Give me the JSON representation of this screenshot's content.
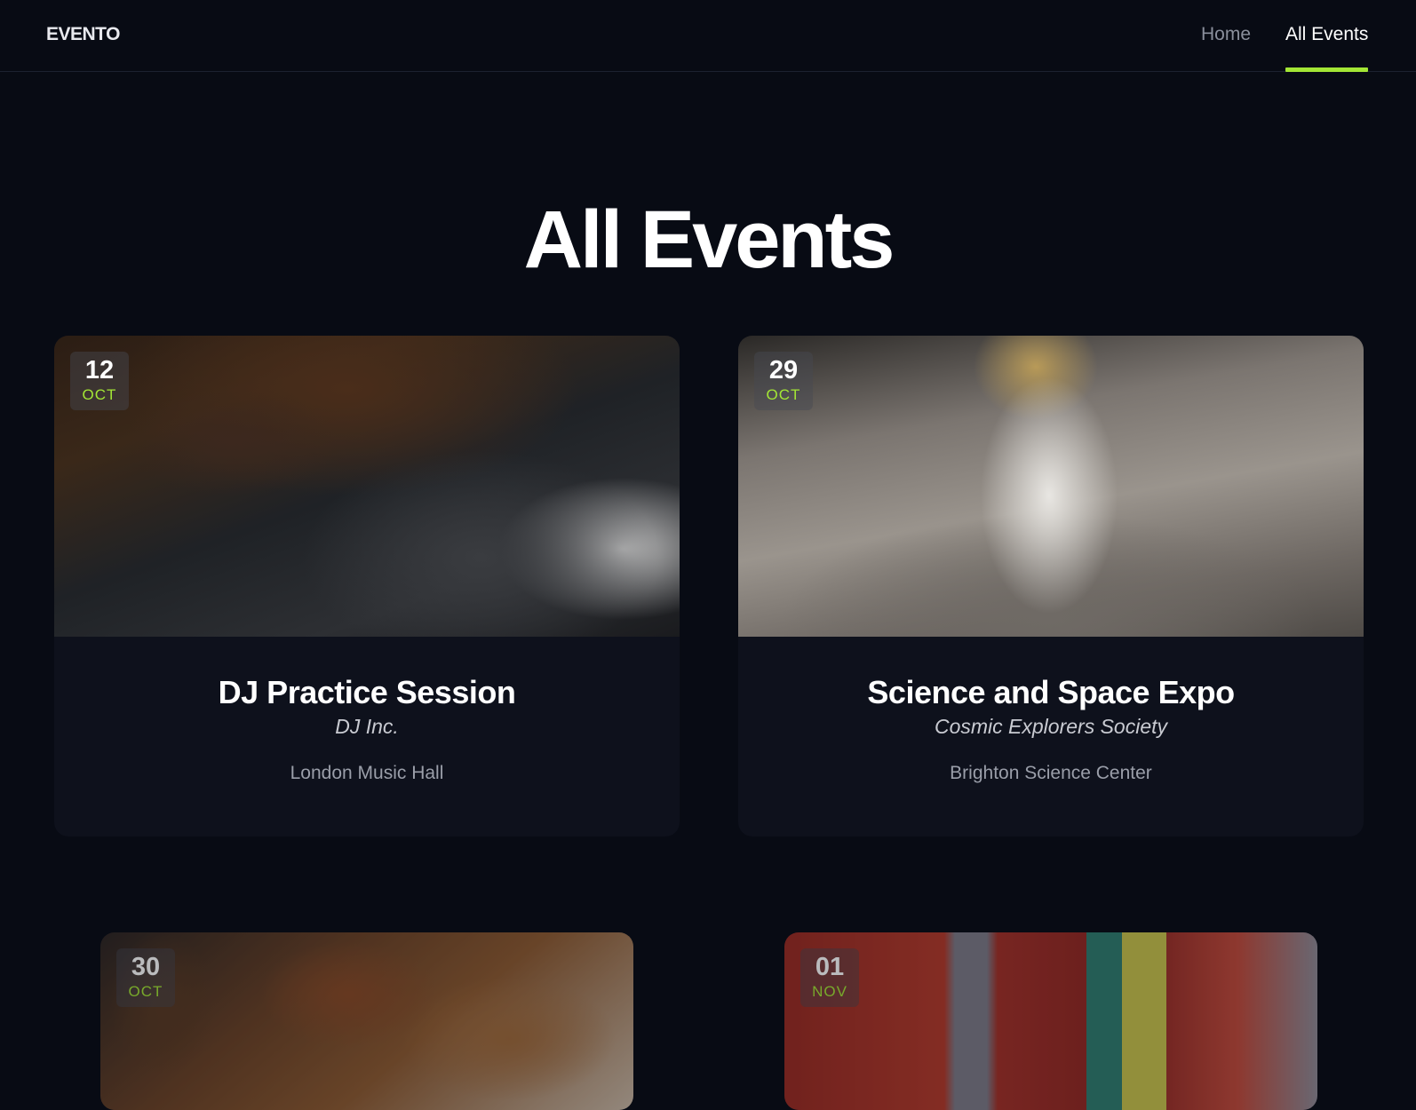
{
  "nav": {
    "logo": "EVENTO",
    "links": [
      {
        "label": "Home"
      },
      {
        "label": "All Events"
      }
    ],
    "active_accent": "#a3e635"
  },
  "page": {
    "title": "All Events"
  },
  "events": [
    {
      "day": "12",
      "month": "OCT",
      "title": "DJ Practice Session",
      "organizer": "DJ Inc.",
      "venue": "London Music Hall"
    },
    {
      "day": "29",
      "month": "OCT",
      "title": "Science and Space Expo",
      "organizer": "Cosmic Explorers Society",
      "venue": "Brighton Science Center"
    },
    {
      "day": "30",
      "month": "OCT"
    },
    {
      "day": "01",
      "month": "NOV"
    }
  ]
}
